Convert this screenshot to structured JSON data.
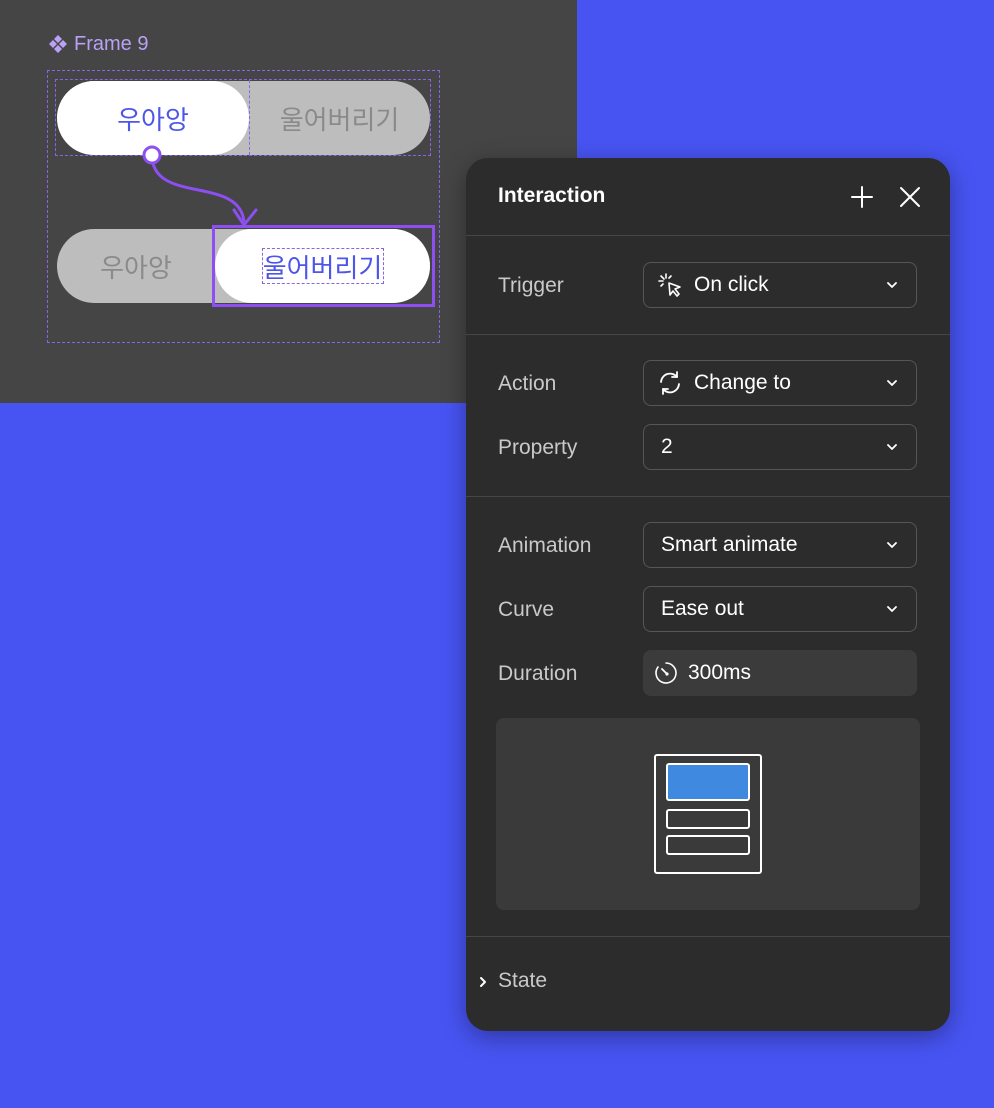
{
  "canvas": {
    "frame_label": "Frame 9",
    "toggle_top": {
      "left_label": "우아앙",
      "right_label": "울어버리기",
      "active": "left"
    },
    "toggle_bottom": {
      "left_label": "우아앙",
      "right_label": "울어버리기",
      "active": "right"
    }
  },
  "panel": {
    "title": "Interaction",
    "add_icon": "plus-icon",
    "close_icon": "close-icon",
    "trigger": {
      "label": "Trigger",
      "value": "On click",
      "icon": "click-cursor-icon"
    },
    "action": {
      "label": "Action",
      "value": "Change to",
      "icon": "refresh-icon"
    },
    "property": {
      "label": "Property",
      "value": "2"
    },
    "animation": {
      "label": "Animation",
      "value": "Smart animate"
    },
    "curve": {
      "label": "Curve",
      "value": "Ease out"
    },
    "duration": {
      "label": "Duration",
      "value": "300ms",
      "icon": "timer-icon"
    },
    "state": {
      "label": "State"
    }
  },
  "colors": {
    "background": "#4754f2",
    "canvas": "#454545",
    "panel": "#2c2c2c",
    "accent_purple": "#8d4ff2",
    "toggle_active_text": "#4d56e8",
    "preview_block": "#3f8ae0"
  }
}
